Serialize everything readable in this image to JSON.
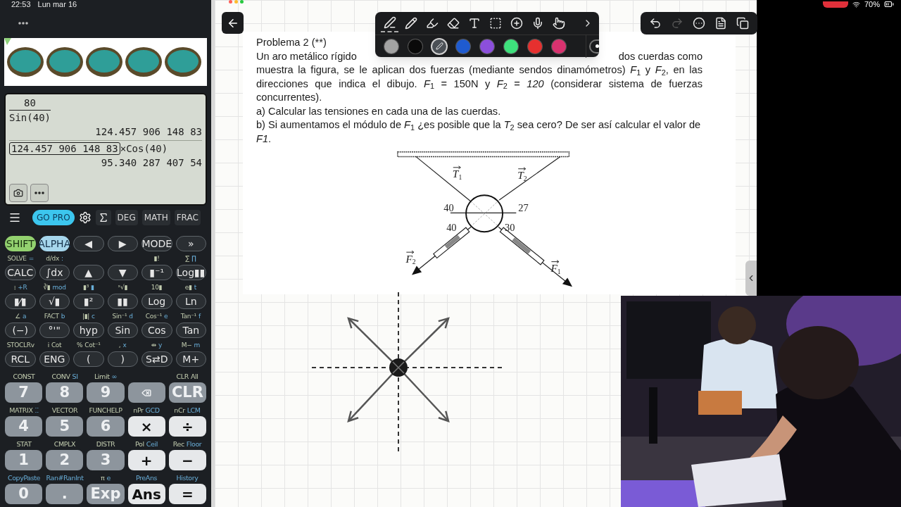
{
  "status_bar": {
    "time": "22:53",
    "date": "Lun mar 16",
    "battery": "70%"
  },
  "calculator": {
    "display": {
      "lines": [
        {
          "kind": "fraction",
          "numerator": "80",
          "denominator": "Sin(40)"
        },
        {
          "kind": "result",
          "text": "124.457 906 148 83"
        },
        {
          "kind": "expression",
          "boxed": "124.457 906 148 83",
          "text": "×Cos(40)"
        },
        {
          "kind": "result",
          "text": "95.340 287 407 54"
        }
      ]
    },
    "toolbar": {
      "promo": "GO PRO",
      "modes": [
        "DEG",
        "MATH",
        "FRAC"
      ]
    },
    "function_rows": [
      {
        "keys": [
          {
            "label": "SHIFT",
            "kind": "shift"
          },
          {
            "label": "ALPHA",
            "kind": "alpha"
          },
          {
            "label": "◀",
            "kind": "fn"
          },
          {
            "label": "▶",
            "kind": "fn"
          },
          {
            "label": "MODE",
            "kind": "fn"
          },
          {
            "label": "»",
            "kind": "fn"
          }
        ]
      },
      {
        "keys": [
          {
            "label": "CALC",
            "kind": "fn",
            "above": [
              {
                "text": "SOLVE",
                "kind": "shift"
              },
              {
                "text": "=",
                "kind": "alpha"
              }
            ]
          },
          {
            "label": "∫dx",
            "kind": "fn",
            "above": [
              {
                "text": "d/dx",
                "kind": "shift"
              },
              {
                "text": ":",
                "kind": "alpha"
              }
            ]
          },
          {
            "label": "▲",
            "kind": "fn"
          },
          {
            "label": "▼",
            "kind": "fn"
          },
          {
            "label": "▮⁻¹",
            "kind": "fn",
            "above": [
              {
                "text": "▮!",
                "kind": "shift"
              }
            ]
          },
          {
            "label": "Log▮▮",
            "kind": "fn",
            "above": [
              {
                "text": "∑",
                "kind": "shift"
              },
              {
                "text": "∏",
                "kind": "alpha"
              }
            ]
          }
        ]
      },
      {
        "keys": [
          {
            "label": "▮⁄▮",
            "kind": "fn",
            "above": [
              {
                "text": "⁝",
                "kind": "shift"
              },
              {
                "text": "+R",
                "kind": "alpha"
              }
            ]
          },
          {
            "label": "√▮",
            "kind": "fn",
            "above": [
              {
                "text": "∛▮",
                "kind": "shift"
              },
              {
                "text": "mod",
                "kind": "alpha"
              }
            ]
          },
          {
            "label": "▮²",
            "kind": "fn",
            "above": [
              {
                "text": "▮³",
                "kind": "shift"
              },
              {
                "text": "▮",
                "kind": "alpha"
              }
            ]
          },
          {
            "label": "▮▮",
            "kind": "fn",
            "above": [
              {
                "text": "ˣ√▮",
                "kind": "shift"
              }
            ]
          },
          {
            "label": "Log",
            "kind": "fn",
            "above": [
              {
                "text": "10▮",
                "kind": "shift"
              }
            ]
          },
          {
            "label": "Ln",
            "kind": "fn",
            "above": [
              {
                "text": "e▮",
                "kind": "shift"
              },
              {
                "text": "t",
                "kind": "alpha"
              }
            ]
          }
        ]
      },
      {
        "keys": [
          {
            "label": "(−)",
            "kind": "fn",
            "above": [
              {
                "text": "∠",
                "kind": "shift"
              },
              {
                "text": "a",
                "kind": "alpha"
              }
            ]
          },
          {
            "label": "°'\"",
            "kind": "fn",
            "above": [
              {
                "text": "FACT",
                "kind": "shift"
              },
              {
                "text": "b",
                "kind": "alpha"
              }
            ]
          },
          {
            "label": "hyp",
            "kind": "fn",
            "above": [
              {
                "text": "|▮|",
                "kind": "shift"
              },
              {
                "text": "c",
                "kind": "alpha"
              }
            ]
          },
          {
            "label": "Sin",
            "kind": "fn",
            "above": [
              {
                "text": "Sin⁻¹",
                "kind": "shift"
              },
              {
                "text": "d",
                "kind": "alpha"
              }
            ]
          },
          {
            "label": "Cos",
            "kind": "fn",
            "above": [
              {
                "text": "Cos⁻¹",
                "kind": "shift"
              },
              {
                "text": "e",
                "kind": "alpha"
              }
            ]
          },
          {
            "label": "Tan",
            "kind": "fn",
            "above": [
              {
                "text": "Tan⁻¹",
                "kind": "shift"
              },
              {
                "text": "f",
                "kind": "alpha"
              }
            ]
          }
        ]
      },
      {
        "keys": [
          {
            "label": "RCL",
            "kind": "fn",
            "above": [
              {
                "text": "STOCLRv",
                "kind": "shift"
              }
            ]
          },
          {
            "label": "ENG",
            "kind": "fn",
            "above": [
              {
                "text": "i",
                "kind": "shift"
              },
              {
                "text": "Cot",
                "kind": "shift"
              }
            ]
          },
          {
            "label": "(",
            "kind": "fn",
            "above": [
              {
                "text": "%",
                "kind": "shift"
              },
              {
                "text": "Cot⁻¹",
                "kind": "shift"
              }
            ]
          },
          {
            "label": ")",
            "kind": "fn",
            "above": [
              {
                "text": ",",
                "kind": "shift"
              },
              {
                "text": "x",
                "kind": "alpha"
              }
            ]
          },
          {
            "label": "S⇄D",
            "kind": "fn",
            "above": [
              {
                "text": "⇹",
                "kind": "shift"
              },
              {
                "text": "y",
                "kind": "alpha"
              }
            ]
          },
          {
            "label": "M+",
            "kind": "fn",
            "above": [
              {
                "text": "M−",
                "kind": "shift"
              },
              {
                "text": "m",
                "kind": "alpha"
              }
            ]
          }
        ]
      }
    ],
    "number_rows": [
      {
        "keys": [
          {
            "label": "7",
            "kind": "digit",
            "above": [
              {
                "text": "CONST",
                "kind": "shift"
              }
            ]
          },
          {
            "label": "8",
            "kind": "digit",
            "above": [
              {
                "text": "CONV",
                "kind": "shift"
              },
              {
                "text": "SI",
                "kind": "alpha"
              }
            ]
          },
          {
            "label": "9",
            "kind": "digit",
            "above": [
              {
                "text": "Limit",
                "kind": "shift"
              },
              {
                "text": "∞",
                "kind": "alpha"
              }
            ]
          },
          {
            "kind": "backspace"
          },
          {
            "label": "CLR",
            "kind": "digit",
            "above": [
              {
                "text": "CLR",
                "kind": "shift"
              },
              {
                "text": "All",
                "kind": "shift"
              }
            ]
          }
        ]
      },
      {
        "keys": [
          {
            "label": "4",
            "kind": "digit",
            "above": [
              {
                "text": "MATRIX",
                "kind": "shift"
              },
              {
                "text": "⁚⁚",
                "kind": "alpha"
              }
            ]
          },
          {
            "label": "5",
            "kind": "digit",
            "above": [
              {
                "text": "VECTOR",
                "kind": "shift"
              }
            ]
          },
          {
            "label": "6",
            "kind": "digit",
            "above": [
              {
                "text": "FUNCHELP",
                "kind": "shift"
              }
            ]
          },
          {
            "label": "×",
            "kind": "op",
            "above": [
              {
                "text": "nPr",
                "kind": "shift"
              },
              {
                "text": "GCD",
                "kind": "alpha"
              }
            ]
          },
          {
            "label": "÷",
            "kind": "op",
            "above": [
              {
                "text": "nCr",
                "kind": "shift"
              },
              {
                "text": "LCM",
                "kind": "alpha"
              }
            ]
          }
        ]
      },
      {
        "keys": [
          {
            "label": "1",
            "kind": "digit",
            "above": [
              {
                "text": "STAT",
                "kind": "shift"
              }
            ]
          },
          {
            "label": "2",
            "kind": "digit",
            "above": [
              {
                "text": "CMPLX",
                "kind": "shift"
              }
            ]
          },
          {
            "label": "3",
            "kind": "digit",
            "above": [
              {
                "text": "DISTR",
                "kind": "shift"
              }
            ]
          },
          {
            "label": "+",
            "kind": "op",
            "above": [
              {
                "text": "Pol",
                "kind": "shift"
              },
              {
                "text": "Ceil",
                "kind": "alpha"
              }
            ]
          },
          {
            "label": "−",
            "kind": "op",
            "above": [
              {
                "text": "Rec",
                "kind": "shift"
              },
              {
                "text": "Floor",
                "kind": "alpha"
              }
            ]
          }
        ]
      },
      {
        "keys": [
          {
            "label": "0",
            "kind": "digit",
            "above": [
              {
                "text": "CopyPaste",
                "kind": "alpha"
              }
            ]
          },
          {
            "label": ".",
            "kind": "digit",
            "above": [
              {
                "text": "Ran#RanInt",
                "kind": "alpha"
              }
            ]
          },
          {
            "label": "Exp",
            "kind": "digit",
            "above": [
              {
                "text": "π",
                "kind": "shift"
              },
              {
                "text": "e",
                "kind": "alpha"
              }
            ]
          },
          {
            "label": "Ans",
            "kind": "op",
            "above": [
              {
                "text": "PreAns",
                "kind": "alpha"
              }
            ]
          },
          {
            "label": "=",
            "kind": "op",
            "above": [
              {
                "text": "History",
                "kind": "alpha"
              }
            ]
          }
        ]
      }
    ]
  },
  "toolbar": {
    "tools": [
      {
        "kind": "pen",
        "selected": true
      },
      {
        "kind": "pencil",
        "selected": false
      },
      {
        "kind": "highlighter",
        "selected": false
      },
      {
        "kind": "eraser",
        "selected": false
      },
      {
        "kind": "text",
        "selected": false
      },
      {
        "kind": "lasso",
        "selected": false
      },
      {
        "kind": "add",
        "selected": false
      },
      {
        "kind": "mic",
        "selected": false
      },
      {
        "kind": "hand",
        "selected": false
      }
    ],
    "palette": [
      {
        "color": "#a3a3a3",
        "selected": false
      },
      {
        "color": "#0a0a0a",
        "selected": false
      },
      {
        "color": "#4b5056",
        "selected": true
      },
      {
        "color": "#1f5bd0",
        "selected": false
      },
      {
        "color": "#8c4fdc",
        "selected": false
      },
      {
        "color": "#3ee07c",
        "selected": false
      },
      {
        "color": "#e6302f",
        "selected": false
      },
      {
        "color": "#d9326f",
        "selected": false
      }
    ],
    "actions": [
      {
        "kind": "undo",
        "disabled": false
      },
      {
        "kind": "redo",
        "disabled": true
      },
      {
        "kind": "more",
        "disabled": false
      },
      {
        "kind": "document",
        "disabled": false
      },
      {
        "kind": "copy",
        "disabled": false
      }
    ]
  },
  "document": {
    "title": "Problema 2 (**)",
    "intro_left": "Un aro metálico rígido",
    "intro_right": "dos cuerdas como",
    "body": "muestra la figura, se le aplican dos fuerzas (mediante sendos dinamómetros) *F*$_{1}$ y *F*$_{2}$,  en las direcciones que indica el dibujo. *F*$_{1}$ = 150N y *F*$_{2}$ = *120* (considerar sistema de fuerzas concurrentes).",
    "items": [
      "a) Calcular las tensiones en cada una de las cuerdas.",
      "b) Si aumentamos el módulo de *F*$_{1}$ ¿es posible que la *T*$_{2}$  sea cero?  De ser así calcular el valor de *F1*."
    ],
    "diagram": {
      "vectors": [
        {
          "symbol": "T",
          "index": "1"
        },
        {
          "symbol": "T",
          "index": "2"
        },
        {
          "symbol": "F",
          "index": "2"
        },
        {
          "symbol": "F",
          "index": "1"
        }
      ],
      "angles": [
        "40",
        "27",
        "40",
        "30"
      ]
    }
  }
}
